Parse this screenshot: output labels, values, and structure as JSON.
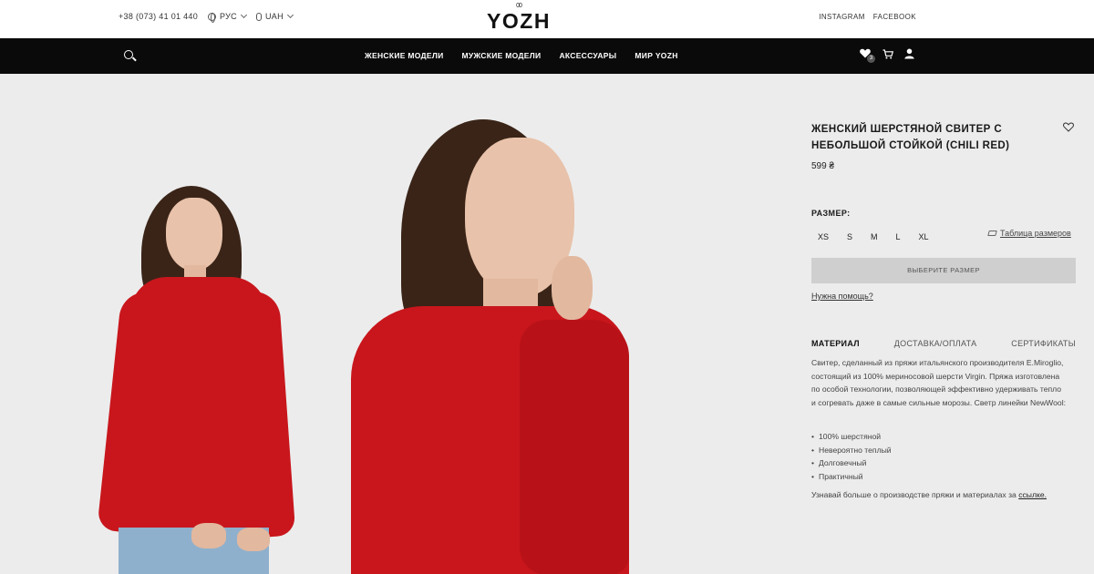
{
  "header": {
    "phone": "+38 (073) 41 01 440",
    "language": "РУС",
    "currency": "UAH",
    "logo_mark": "00",
    "logo_text": "YOZH",
    "social": [
      "INSTAGRAM",
      "FACEBOOK"
    ]
  },
  "nav": {
    "items": [
      "ЖЕНСКИЕ МОДЕЛИ",
      "МУЖСКИЕ МОДЕЛИ",
      "АКСЕССУАРЫ",
      "МИР YOZH"
    ],
    "wishlist_count": "3",
    "icons": [
      "search-icon",
      "heart-icon",
      "cart-icon",
      "user-icon"
    ]
  },
  "product": {
    "title": "ЖЕНСКИЙ ШЕРСТЯНОЙ СВИТЕР С НЕБОЛЬШОЙ СТОЙКОЙ (CHILI RED)",
    "price": "599 ₴",
    "size_label": "РАЗМЕР:",
    "sizes": [
      "XS",
      "S",
      "M",
      "L",
      "XL"
    ],
    "size_table_link": "Таблица размеров",
    "choose_button": "ВЫБЕРИТЕ РАЗМЕР",
    "help_link": "Нужна помощь?",
    "tabs": [
      "МАТЕРИАЛ",
      "ДОСТАВКА/ОПЛАТА",
      "СЕРТИФИКАТЫ"
    ],
    "description": "Свитер, сделанный из пряжи итальянского производителя E.Miroglio, состоящий из 100% мериносовой шерсти Virgin. Пряжа изготовлена по особой технологии, позволяющей эффективно удерживать тепло и согревать даже в самые сильные морозы. Светр линейки NewWool:",
    "features": [
      "100% шерстяной",
      "Невероятно теплый",
      "Долговечный",
      "Практичный"
    ],
    "more_text": "Узнавай больше о производстве пряжи и материалах за ",
    "more_link": "ссылке."
  },
  "colors": {
    "nav_bg": "#0a0a0a",
    "photo_bg": "#ececec",
    "sweater": "#c8161c",
    "button_bg": "#cfcfcf"
  }
}
